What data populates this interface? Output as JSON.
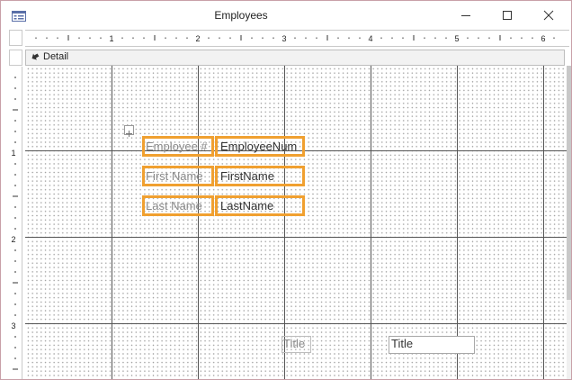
{
  "window": {
    "title": "Employees",
    "app_icon": "form-icon",
    "controls": [
      "minimize-icon",
      "maximize-icon",
      "close-icon"
    ]
  },
  "ruler": {
    "horizontal_labels": [
      "1",
      "2",
      "3",
      "4",
      "5",
      "6"
    ],
    "vertical_labels": [
      "1",
      "2",
      "3"
    ]
  },
  "section": {
    "icon": "section-arrow-icon",
    "label": "Detail"
  },
  "controls": {
    "employee_label": "Employee #",
    "employee_field": "EmployeeNum",
    "firstname_label": "First Name",
    "firstname_field": "FirstName",
    "lastname_label": "Last Name",
    "lastname_field": "LastName",
    "title_label": "Title",
    "title_field": "Title"
  },
  "colors": {
    "selection": "#f0a030",
    "grid_line": "#555555",
    "section_bar": "#f2f2f2"
  }
}
